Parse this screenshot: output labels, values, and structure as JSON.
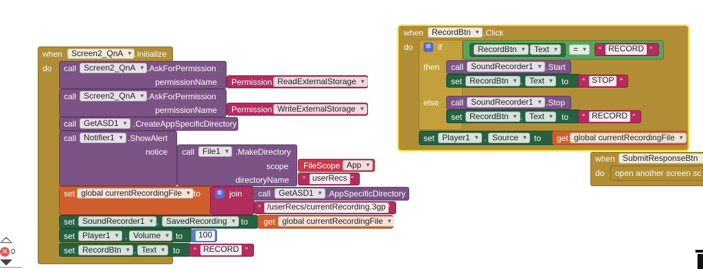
{
  "screen_init": {
    "when": "when",
    "component": "Screen2_QnA",
    "event": ".Initialize",
    "do": "do",
    "ask1": {
      "call": "call",
      "component": "Screen2_QnA",
      "method": ".AskForPermission",
      "param": "permissionName",
      "perm_label": "Permission",
      "perm_value": "ReadExternalStorage"
    },
    "ask2": {
      "call": "call",
      "component": "Screen2_QnA",
      "method": ".AskForPermission",
      "param": "permissionName",
      "perm_label": "Permission",
      "perm_value": "WriteExternalStorage"
    },
    "create_dir": {
      "call": "call",
      "component": "GetASD1",
      "method": ".CreateAppSpecificDirectory"
    },
    "show_alert": {
      "call": "call",
      "component": "Notifier1",
      "method": ".ShowAlert",
      "param": "notice",
      "inner_call": "call",
      "inner_component": "File1",
      "inner_method": ".MakeDirectory",
      "scope_param": "scope",
      "scope_label": "FileScope",
      "scope_value": "App",
      "dir_param": "directoryName",
      "dir_value": "userRecs"
    },
    "set_var": {
      "set": "set",
      "var": "global currentRecordingFile",
      "to": "to",
      "join": "join",
      "call": "call",
      "component": "GetASD1",
      "method": ".AppSpecificDirectory",
      "path": "/userRecs/currentRecording.3gp"
    },
    "set_saved": {
      "set": "set",
      "component": "SoundRecorder1",
      "prop": "SavedRecording",
      "to": "to",
      "get": "get",
      "var": "global currentRecordingFile"
    },
    "set_volume": {
      "set": "set",
      "component": "Player1",
      "prop": "Volume",
      "to": "to",
      "value": "100"
    },
    "set_text": {
      "set": "set",
      "component": "RecordBtn",
      "prop": "Text",
      "to": "to",
      "value": "RECORD"
    }
  },
  "record_click": {
    "when": "when",
    "component": "RecordBtn",
    "event": ".Click",
    "do": "do",
    "if": "if",
    "cmp_component": "RecordBtn",
    "cmp_prop": "Text",
    "op": "=",
    "cmp_value": "RECORD",
    "then": "then",
    "else": "else",
    "start": {
      "call": "call",
      "component": "SoundRecorder1",
      "method": ".Start"
    },
    "set_stop": {
      "set": "set",
      "component": "RecordBtn",
      "prop": "Text",
      "to": "to",
      "value": "STOP"
    },
    "stop": {
      "call": "call",
      "component": "SoundRecorder1",
      "method": ".Stop"
    },
    "set_record": {
      "set": "set",
      "component": "RecordBtn",
      "prop": "Text",
      "to": "to",
      "value": "RECORD"
    },
    "set_source": {
      "set": "set",
      "component": "Player1",
      "prop": "Source",
      "to": "to",
      "get": "get",
      "var": "global currentRecordingFile"
    }
  },
  "submit_click": {
    "when": "when",
    "component": "SubmitResponseBtn",
    "do": "do",
    "body": "open another screen  sc"
  },
  "warnings": {
    "error_count": "0"
  },
  "colors": {
    "event": "#b18e35",
    "procedure": "#7c5385",
    "setter": "#266141",
    "variable": "#d05f2d",
    "text": "#b32d5e",
    "logic": "#5ba55b",
    "math": "#5b80c5"
  }
}
